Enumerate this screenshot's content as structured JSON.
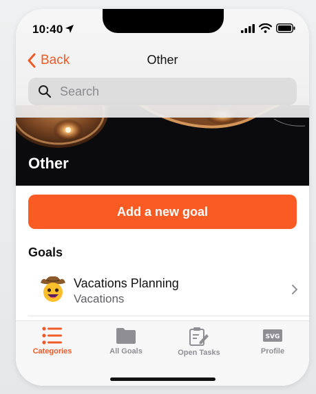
{
  "status": {
    "time": "10:40"
  },
  "nav": {
    "back_label": "Back",
    "title": "Other"
  },
  "search": {
    "placeholder": "Search",
    "value": ""
  },
  "hero": {
    "title": "Other"
  },
  "actions": {
    "add_goal_label": "Add a new goal"
  },
  "goals": {
    "section_title": "Goals",
    "items": [
      {
        "title": "Vacations Planning",
        "subtitle": "Vacations",
        "icon": "cowboy-face-icon"
      }
    ]
  },
  "tabs": [
    {
      "label": "Categories",
      "icon": "list-icon",
      "active": true
    },
    {
      "label": "All Goals",
      "icon": "folder-icon",
      "active": false
    },
    {
      "label": "Open Tasks",
      "icon": "clipboard-edit-icon",
      "active": false
    },
    {
      "label": "Profile",
      "icon": "svg-badge-icon",
      "active": false
    }
  ],
  "colors": {
    "accent": "#fa5b24",
    "accent_text": "#f05a28",
    "tab_inactive": "#8e8e93",
    "hero_bg": "#0b0b0d"
  }
}
